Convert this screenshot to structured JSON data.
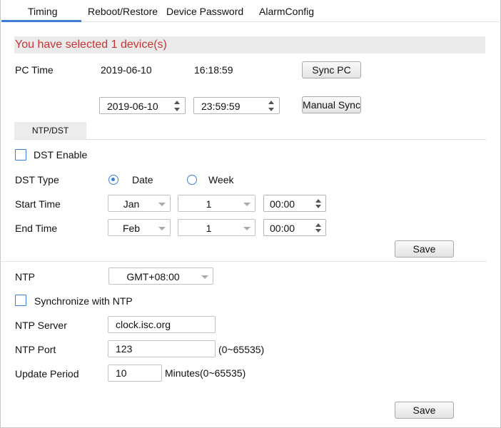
{
  "tabs": [
    {
      "label": "Timing",
      "active": true
    },
    {
      "label": "Reboot/Restore"
    },
    {
      "label": "Device Password"
    },
    {
      "label": "AlarmConfig"
    }
  ],
  "banner": "You have selected 1 device(s)",
  "pc_time": {
    "label": "PC Time",
    "date": "2019-06-10",
    "time": "16:18:59",
    "sync_button": "Sync PC"
  },
  "manual": {
    "date": "2019-06-10",
    "time": "23:59:59",
    "sync_button": "Manual Sync"
  },
  "subtab": "NTP/DST",
  "dst": {
    "enable_label": "DST Enable",
    "type_label": "DST Type",
    "option_date": "Date",
    "option_week": "Week",
    "selected_type": "Date",
    "start_label": "Start Time",
    "start_month": "Jan",
    "start_day": "1",
    "start_time": "00:00",
    "end_label": "End Time",
    "end_month": "Feb",
    "end_day": "1",
    "end_time": "00:00",
    "save_button": "Save"
  },
  "ntp": {
    "label": "NTP",
    "timezone": "GMT+08:00",
    "sync_label": "Synchronize with NTP",
    "server_label": "NTP Server",
    "server_value": "clock.isc.org",
    "port_label": "NTP Port",
    "port_value": "123",
    "port_range": "(0~65535)",
    "period_label": "Update Period",
    "period_value": "10",
    "period_unit": "Minutes(0~65535)",
    "save_button": "Save"
  },
  "colors": {
    "accent": "#3b7fd4",
    "banner_text": "#cc3333"
  }
}
